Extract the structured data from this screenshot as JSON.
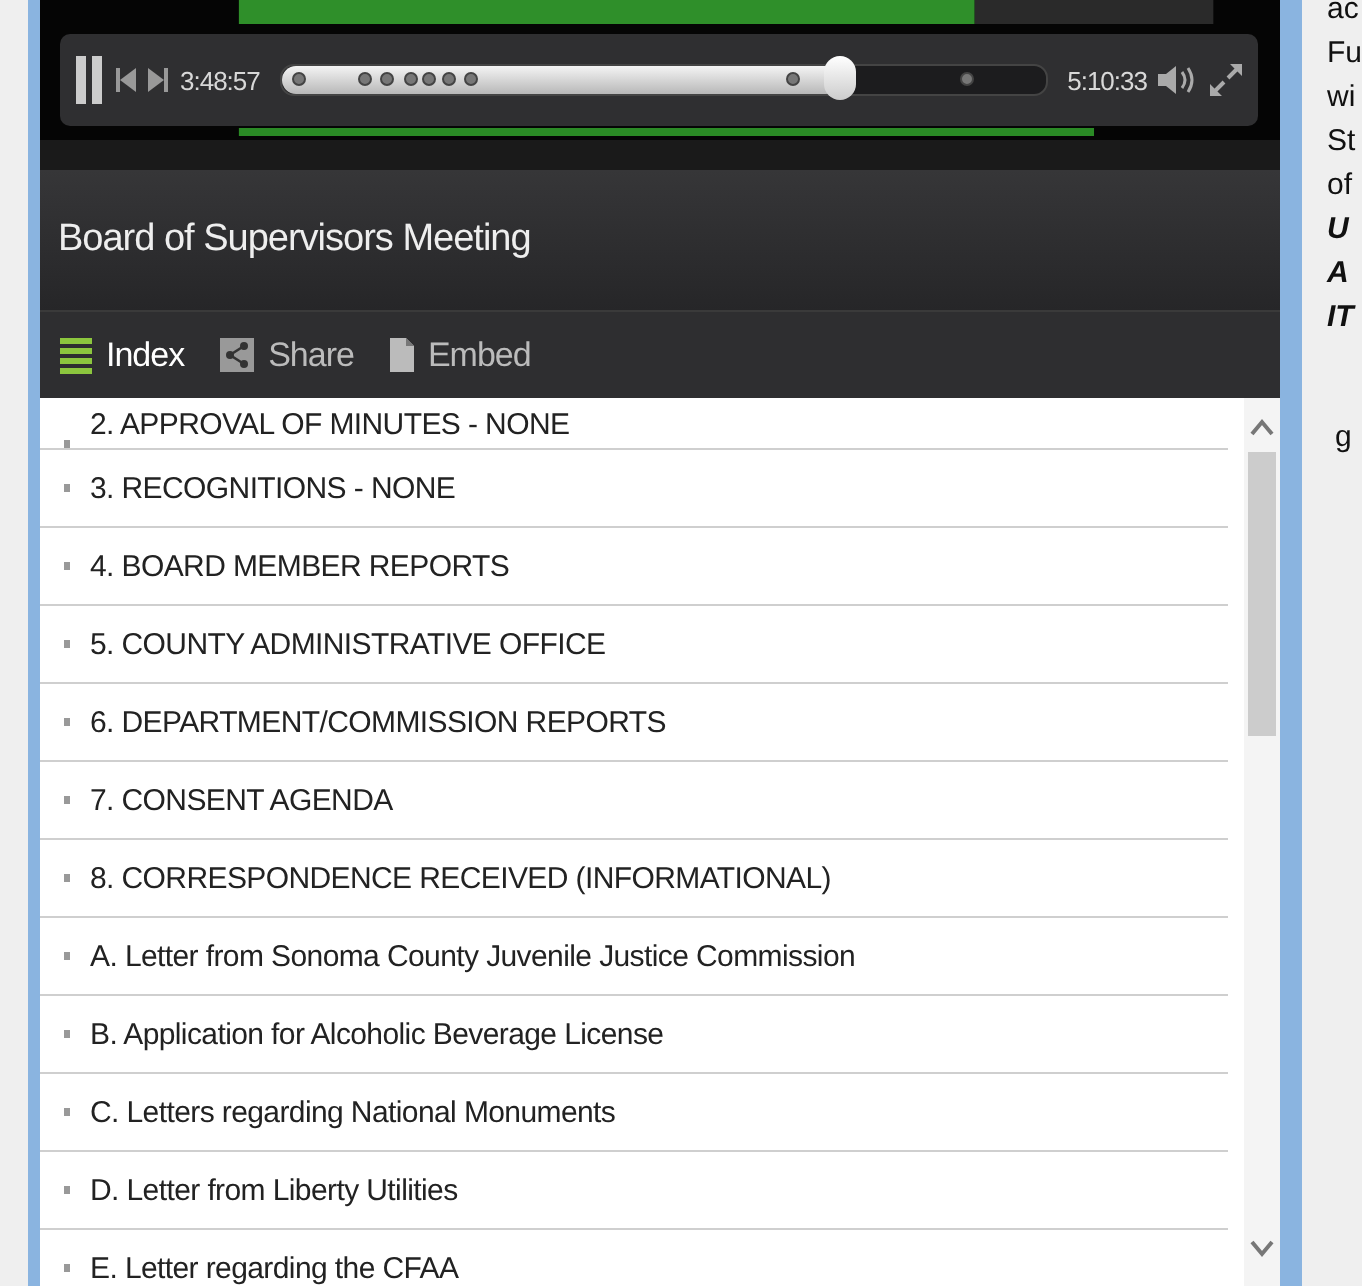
{
  "player": {
    "elapsed": "3:48:57",
    "total": "5:10:33",
    "level": 0.73,
    "playing": true
  },
  "title": "Board of Supervisors Meeting",
  "tabs": [
    {
      "label": "Index",
      "selected": true
    },
    {
      "label": "Share",
      "selected": false
    },
    {
      "label": "Embed",
      "selected": false
    }
  ],
  "agenda": [
    {
      "label": "2. APPROVAL OF MINUTES - NONE"
    },
    {
      "label": "3. RECOGNITIONS - NONE"
    },
    {
      "label": "4.  BOARD MEMBER REPORTS"
    },
    {
      "label": "5.  COUNTY ADMINISTRATIVE OFFICE"
    },
    {
      "label": "6.  DEPARTMENT/COMMISSION REPORTS"
    },
    {
      "label": "7.  CONSENT AGENDA"
    },
    {
      "label": "8.  CORRESPONDENCE RECEIVED (INFORMATIONAL)"
    },
    {
      "label": "A.  Letter from Sonoma County Juvenile Justice Commission"
    },
    {
      "label": "B.  Application for Alcoholic Beverage License"
    },
    {
      "label": "C.  Letters regarding National Monuments"
    },
    {
      "label": "D.  Letter from Liberty Utilities"
    },
    {
      "label": "E.  Letter regarding the CFAA"
    }
  ],
  "side_text": [
    {
      "text": "ac",
      "emphasis": false
    },
    {
      "text": "Fu",
      "emphasis": false
    },
    {
      "text": "wi",
      "emphasis": false
    },
    {
      "text": "St",
      "emphasis": false
    },
    {
      "text": "of",
      "emphasis": false
    },
    {
      "text": "U",
      "emphasis": true
    },
    {
      "text": "A",
      "emphasis": true
    },
    {
      "text": "IT",
      "emphasis": true
    },
    {
      "text": "g",
      "emphasis": false,
      "gap": true
    }
  ]
}
